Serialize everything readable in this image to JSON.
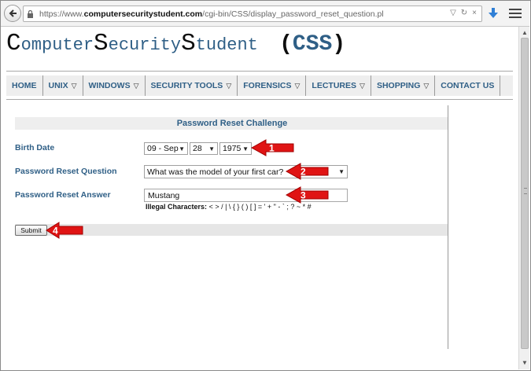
{
  "browser": {
    "url_prefix": "https://www.",
    "url_domain": "computersecuritystudent.com",
    "url_path": "/cgi-bin/CSS/display_password_reset_question.pl"
  },
  "site": {
    "title_parts": [
      "C",
      "omputer",
      "S",
      "ecurity",
      "S",
      "tudent",
      "(",
      "CSS",
      ")"
    ]
  },
  "nav": {
    "items": [
      {
        "label": "HOME",
        "dropdown": false
      },
      {
        "label": "UNIX",
        "dropdown": true
      },
      {
        "label": "WINDOWS",
        "dropdown": true
      },
      {
        "label": "SECURITY TOOLS",
        "dropdown": true
      },
      {
        "label": "FORENSICS",
        "dropdown": true
      },
      {
        "label": "LECTURES",
        "dropdown": true
      },
      {
        "label": "SHOPPING",
        "dropdown": true
      },
      {
        "label": "CONTACT US",
        "dropdown": false
      }
    ]
  },
  "form": {
    "header": "Password Reset Challenge",
    "birth_date_label": "Birth Date",
    "birth_month": "09 - Sep",
    "birth_day": "28",
    "birth_year": "1975",
    "question_label": "Password Reset Question",
    "question_value": "What was the model of your first car?",
    "answer_label": "Password Reset Answer",
    "answer_value": "Mustang",
    "illegal_label": "Illegal Characters:",
    "illegal_chars": "< > / | \\ { } ( ) [ ] = ' + \" - ` ; ? ~ * #",
    "submit_label": "Submit"
  },
  "annotations": {
    "arrow_1": "1",
    "arrow_2": "2",
    "arrow_3": "3",
    "arrow_4": "4"
  },
  "colors": {
    "accent": "#2f5f86",
    "arrow_red": "#e01414"
  }
}
